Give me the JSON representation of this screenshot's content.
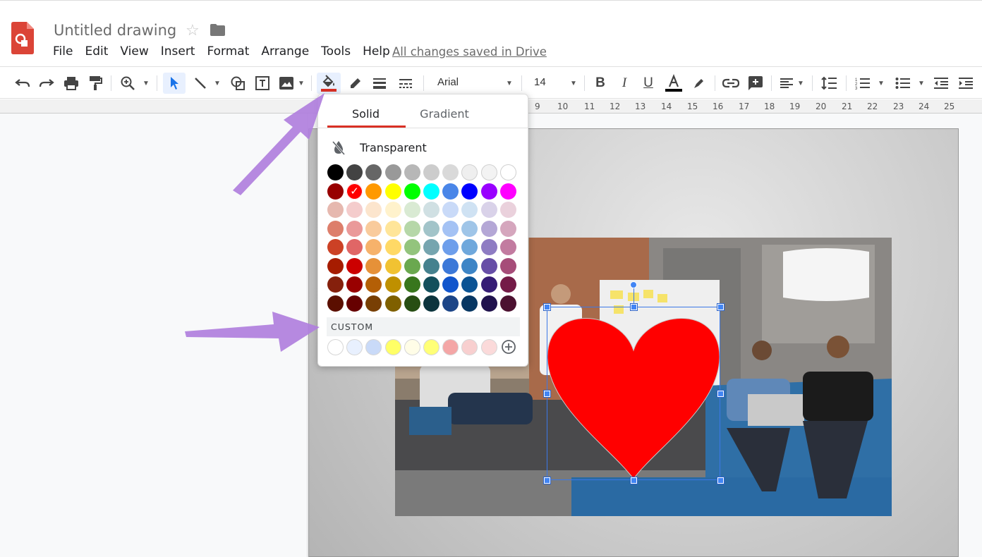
{
  "app": {
    "title": "Untitled drawing",
    "save_status": "All changes saved in Drive"
  },
  "menu": [
    "File",
    "Edit",
    "View",
    "Insert",
    "Format",
    "Arrange",
    "Tools",
    "Help"
  ],
  "toolbar": {
    "font": "Arial",
    "font_size": "14"
  },
  "ruler": [
    "9",
    "10",
    "11",
    "12",
    "13",
    "14",
    "15",
    "16",
    "17",
    "18",
    "19",
    "20",
    "21",
    "22",
    "23",
    "24",
    "25"
  ],
  "fill_popup": {
    "tabs": [
      "Solid",
      "Gradient"
    ],
    "active_tab": "Solid",
    "transparent_label": "Transparent",
    "custom_label": "CUSTOM",
    "selected_color": "#ff0000",
    "palette": [
      [
        "#000000",
        "#434343",
        "#666666",
        "#999999",
        "#b7b7b7",
        "#cccccc",
        "#d9d9d9",
        "#efefef",
        "#f3f3f3",
        "#ffffff"
      ],
      [
        "#980000",
        "#ff0000",
        "#ff9900",
        "#ffff00",
        "#00ff00",
        "#00ffff",
        "#4a86e8",
        "#0000ff",
        "#9900ff",
        "#ff00ff"
      ],
      [
        "#e6b8af",
        "#f4cccc",
        "#fce5cd",
        "#fff2cc",
        "#d9ead3",
        "#d0e0e3",
        "#c9daf8",
        "#cfe2f3",
        "#d9d2e9",
        "#ead1dc"
      ],
      [
        "#dd7e6b",
        "#ea9999",
        "#f9cb9c",
        "#ffe599",
        "#b6d7a8",
        "#a2c4c9",
        "#a4c2f4",
        "#9fc5e8",
        "#b4a7d6",
        "#d5a6bd"
      ],
      [
        "#cc4125",
        "#e06666",
        "#f6b26b",
        "#ffd966",
        "#93c47d",
        "#76a5af",
        "#6d9eeb",
        "#6fa8dc",
        "#8e7cc3",
        "#c27ba0"
      ],
      [
        "#a61c00",
        "#cc0000",
        "#e69138",
        "#f1c232",
        "#6aa84f",
        "#45818e",
        "#3c78d8",
        "#3d85c6",
        "#674ea7",
        "#a64d79"
      ],
      [
        "#85200c",
        "#990000",
        "#b45f06",
        "#bf9000",
        "#38761d",
        "#134f5c",
        "#1155cc",
        "#0b5394",
        "#351c75",
        "#741b47"
      ],
      [
        "#5b0f00",
        "#660000",
        "#783f04",
        "#7f6000",
        "#274e13",
        "#0c343d",
        "#1c4587",
        "#073763",
        "#20124d",
        "#4c1130"
      ]
    ],
    "custom_colors": [
      "#ffffff",
      "#e8f0fe",
      "#c9daf8",
      "#ffff66",
      "#fffde7",
      "#ffff77",
      "#f4a6a6",
      "#f8cfcf",
      "#fbdada"
    ]
  },
  "shape": {
    "fill": "#ff0000"
  },
  "colors": {
    "accent": "#d93025",
    "selection": "#4285f4",
    "annotation_arrow": "#b07fdd"
  }
}
